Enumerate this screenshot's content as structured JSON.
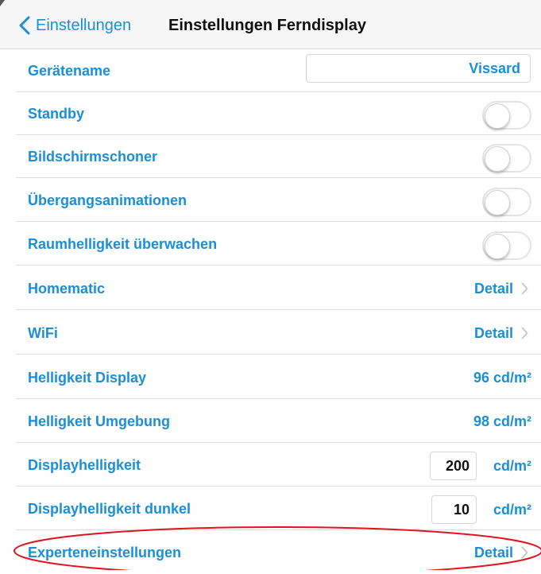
{
  "nav": {
    "back_label": "Einstellungen",
    "title": "Einstellungen Ferndisplay"
  },
  "rows": {
    "device_name": {
      "label": "Gerätename",
      "value": "Vissard"
    },
    "standby": {
      "label": "Standby",
      "on": false
    },
    "screensaver": {
      "label": "Bildschirmschoner",
      "on": false
    },
    "transitions": {
      "label": "Übergangsanimationen",
      "on": false
    },
    "room_brightness": {
      "label": "Raumhelligkeit überwachen",
      "on": false
    },
    "homematic": {
      "label": "Homematic",
      "detail": "Detail"
    },
    "wifi": {
      "label": "WiFi",
      "detail": "Detail"
    },
    "brightness_display": {
      "label": "Helligkeit Display",
      "value": "96 cd/m²"
    },
    "brightness_ambient": {
      "label": "Helligkeit Umgebung",
      "value": "98 cd/m²"
    },
    "display_brightness": {
      "label": "Displayhelligkeit",
      "value": "200",
      "unit": "cd/m²"
    },
    "display_brightness_dark": {
      "label": "Displayhelligkeit dunkel",
      "value": "10",
      "unit": "cd/m²"
    },
    "expert": {
      "label": "Experteneinstellungen",
      "detail": "Detail"
    }
  },
  "colors": {
    "accent": "#1a8fd8",
    "highlight": "#e0141e"
  },
  "icons": {
    "back": "chevron-left-icon",
    "detail": "chevron-right-icon"
  }
}
